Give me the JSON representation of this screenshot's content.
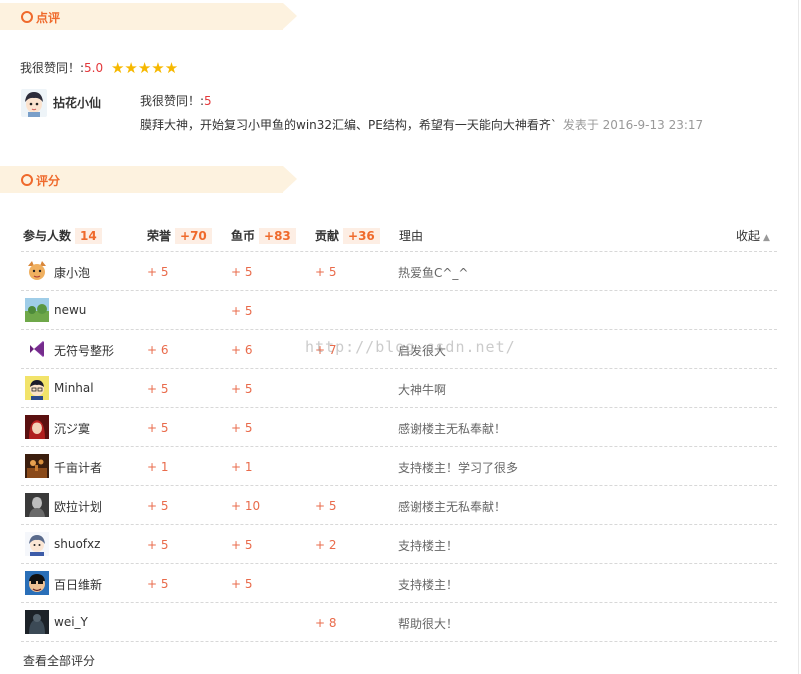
{
  "review_section": {
    "title": "点评"
  },
  "rating": {
    "label": "我很赞同！:",
    "score": "5.0",
    "stars": "★★★★★"
  },
  "review": {
    "user": "拈花小仙",
    "line1_label": "我很赞同！:",
    "line1_score": "5",
    "text": "膜拜大神，开始复习小甲鱼的win32汇编、PE结构，希望有一天能向大神看齐`",
    "time": "发表于 2016-9-13 23:17"
  },
  "score_section": {
    "title": "评分"
  },
  "table": {
    "participants_label": "参与人数",
    "participants_count": "14",
    "col_honor": "荣誉",
    "col_honor_total": "+70",
    "col_coin": "鱼币",
    "col_coin_total": "+83",
    "col_contrib": "贡献",
    "col_contrib_total": "+36",
    "col_reason": "理由",
    "collapse_label": "收起",
    "rows": [
      {
        "name": "康小泡",
        "honor": "+ 5",
        "coin": "+ 5",
        "contrib": "+ 5",
        "reason": "热爱鱼C^_^"
      },
      {
        "name": "newu",
        "honor": "",
        "coin": "+ 5",
        "contrib": "",
        "reason": ""
      },
      {
        "name": "无符号整形",
        "honor": "+ 6",
        "coin": "+ 6",
        "contrib": "+ 7",
        "reason": "启发很大"
      },
      {
        "name": "Minhal",
        "honor": "+ 5",
        "coin": "+ 5",
        "contrib": "",
        "reason": "大神牛啊"
      },
      {
        "name": "沉ジ寞",
        "honor": "+ 5",
        "coin": "+ 5",
        "contrib": "",
        "reason": "感谢楼主无私奉献！"
      },
      {
        "name": "千亩计者",
        "honor": "+ 1",
        "coin": "+ 1",
        "contrib": "",
        "reason": "支持楼主！学习了很多"
      },
      {
        "name": "欧拉计划",
        "honor": "+ 5",
        "coin": "+ 10",
        "contrib": "+ 5",
        "reason": "感谢楼主无私奉献！"
      },
      {
        "name": "shuofxz",
        "honor": "+ 5",
        "coin": "+ 5",
        "contrib": "+ 2",
        "reason": "支持楼主！"
      },
      {
        "name": "百日维新",
        "honor": "+ 5",
        "coin": "+ 5",
        "contrib": "",
        "reason": "支持楼主！"
      },
      {
        "name": "wei_Y",
        "honor": "",
        "coin": "",
        "contrib": "+ 8",
        "reason": "帮助很大！"
      }
    ]
  },
  "view_all_label": "查看全部评分",
  "watermark": "http://blog.csdn.net/",
  "colors": {
    "accent": "#ef6a2c",
    "header_band": "#fdf2df",
    "score_red": "#e96b4b"
  }
}
